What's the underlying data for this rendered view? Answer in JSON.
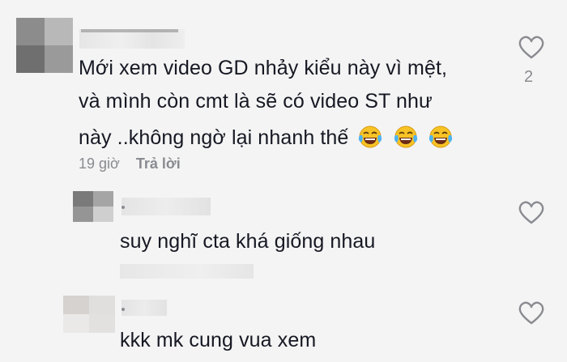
{
  "comments": [
    {
      "text_lines": [
        "Mới xem video GD nhảy kiểu này vì mệt,",
        "và mình còn cmt là sẽ có video ST như",
        "này ..không ngờ lại nhanh thế"
      ],
      "emoji": [
        "tears-of-joy-emoji",
        "tears-of-joy-emoji",
        "tears-of-joy-emoji"
      ],
      "time": "19 giờ",
      "reply_label": "Trả lời",
      "like_count": "2",
      "avatar_colors": [
        "#8c8c8c",
        "#b8b8b8",
        "#6f6f6f",
        "#9a9a9a"
      ]
    },
    {
      "text": "suy nghĩ cta khá giống nhau",
      "avatar_colors": [
        "#7a7a7a",
        "#a5a5a5",
        "#959595",
        "#cfcfcf"
      ]
    },
    {
      "text": "kkk mk cung vua xem",
      "avatar_colors": [
        "#d5d2cf",
        "#e1dfdd",
        "#ebe9e7",
        "#e3e1df"
      ]
    }
  ],
  "icons": {
    "like": "heart-outline-icon"
  },
  "colors": {
    "background": "#f4f4f4",
    "text": "#161823",
    "muted": "#8a8b91"
  }
}
